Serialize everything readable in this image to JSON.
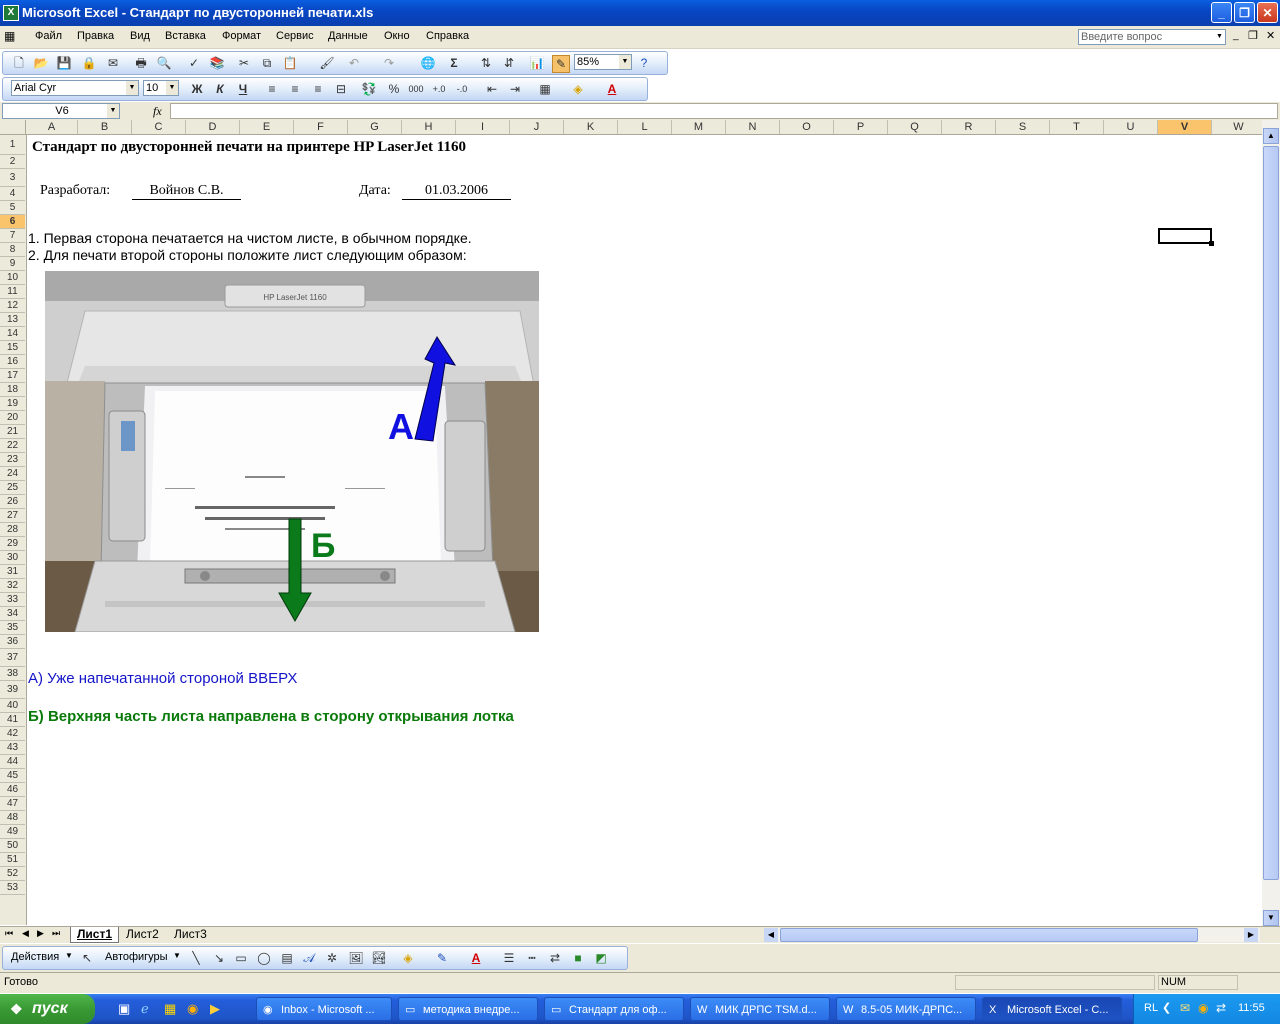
{
  "window": {
    "title": "Microsoft Excel - Стандарт по двусторонней печати.xls"
  },
  "menu": [
    "Файл",
    "Правка",
    "Вид",
    "Вставка",
    "Формат",
    "Сервис",
    "Данные",
    "Окно",
    "Справка"
  ],
  "help_box": {
    "placeholder": "Введите вопрос"
  },
  "toolbar": {
    "zoom": "85%",
    "font_name": "Arial Cyr",
    "font_size": "10",
    "bold": "Ж",
    "italic": "К",
    "underline": "Ч",
    "percent": "%",
    "thousands": "000",
    "sigma": "Σ"
  },
  "formula_bar": {
    "name_box": "V6",
    "fx": "fx",
    "content": ""
  },
  "columns": [
    "A",
    "B",
    "C",
    "D",
    "E",
    "F",
    "G",
    "H",
    "I",
    "J",
    "K",
    "L",
    "M",
    "N",
    "O",
    "P",
    "Q",
    "R",
    "S",
    "T",
    "U",
    "V",
    "W"
  ],
  "selected_column": "V",
  "selected_row": "6",
  "rows": [
    "1",
    "2",
    "3",
    "4",
    "5",
    "6",
    "7",
    "8",
    "9",
    "10",
    "11",
    "12",
    "13",
    "14",
    "15",
    "16",
    "17",
    "18",
    "19",
    "20",
    "21",
    "22",
    "23",
    "24",
    "25",
    "26",
    "27",
    "28",
    "29",
    "30",
    "31",
    "32",
    "33",
    "34",
    "35",
    "36",
    "37",
    "38",
    "39",
    "40",
    "41",
    "42",
    "43",
    "44",
    "45",
    "46",
    "47",
    "48",
    "49",
    "50",
    "51",
    "52",
    "53"
  ],
  "sheet": {
    "title": "Стандарт по двусторонней печати на принтере HP LaserJet 1160",
    "developer_label": "Разработал:",
    "developer_value": "Войнов С.В.",
    "date_label": "Дата:",
    "date_value": "01.03.2006",
    "step1": "1. Первая сторона печатается на чистом листе, в обычном порядке.",
    "step2": "2. Для печати второй стороны положите лист следующим образом:",
    "photo_label_printer": "HP LaserJet 1160",
    "arrow_a_label": "А",
    "arrow_b_label": "Б",
    "note_a": "А) Уже напечатанной стороной ВВЕРХ",
    "note_b": "Б) Верхняя часть листа направлена в сторону открывания лотка",
    "colors": {
      "note_a": "#1414c8",
      "note_b": "#0a7a0a",
      "arrow_a": "#1010e0",
      "arrow_b": "#0a7a1a"
    }
  },
  "tabs": [
    "Лист1",
    "Лист2",
    "Лист3"
  ],
  "active_tab": "Лист1",
  "drawing_toolbar": {
    "actions": "Действия",
    "autoshapes": "Автофигуры"
  },
  "status": {
    "left": "Готово",
    "num": "NUM"
  },
  "taskbar": {
    "start": "пуск",
    "tasks": [
      "Inbox - Microsoft ...",
      "методика внедре...",
      "Стандарт для оф...",
      "МИК ДРПС TSM.d...",
      "8.5-05 МИК-ДРПС...",
      "Microsoft Excel - C..."
    ],
    "lang": "RL",
    "clock": "11:55"
  }
}
